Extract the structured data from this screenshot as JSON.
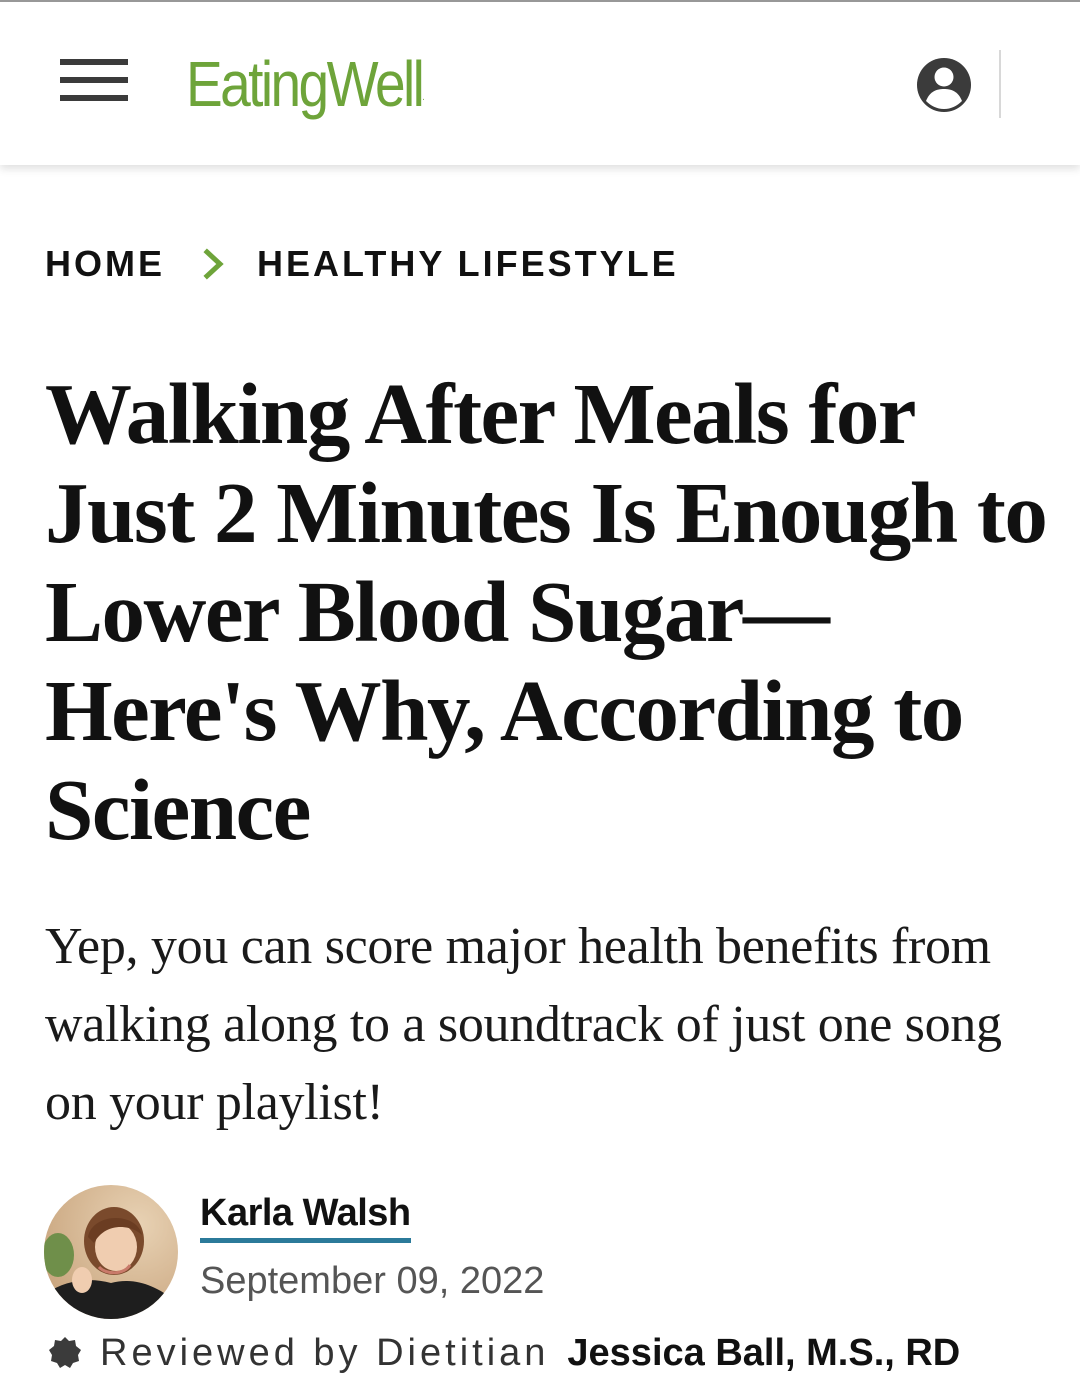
{
  "header": {
    "logo_text": "EatingWell",
    "logo_trademark": ".",
    "brand_color": "#6ea43a"
  },
  "breadcrumb": {
    "items": [
      "HOME",
      "HEALTHY LIFESTYLE"
    ],
    "separator_color": "#6ea43a"
  },
  "article": {
    "headline": "Walking After Meals for Just 2 Minutes Is Enough to Lower Blood Sugar—Here's Why, According to Science",
    "dek": "Yep, you can score major health benefits from walking along to a soundtrack of just one song on your playlist!",
    "author": "Karla Walsh",
    "date": "September 09, 2022",
    "reviewed_by_label": "Reviewed by Dietitian",
    "reviewer": "Jessica Ball, M.S., RD"
  },
  "icons": {
    "menu": "hamburger-menu-icon",
    "account": "user-account-icon",
    "breadcrumb_separator": "chevron-right-icon",
    "reviewed": "badge-check-icon"
  },
  "colors": {
    "author_underline": "#2b7a9a",
    "text": "#111111"
  }
}
